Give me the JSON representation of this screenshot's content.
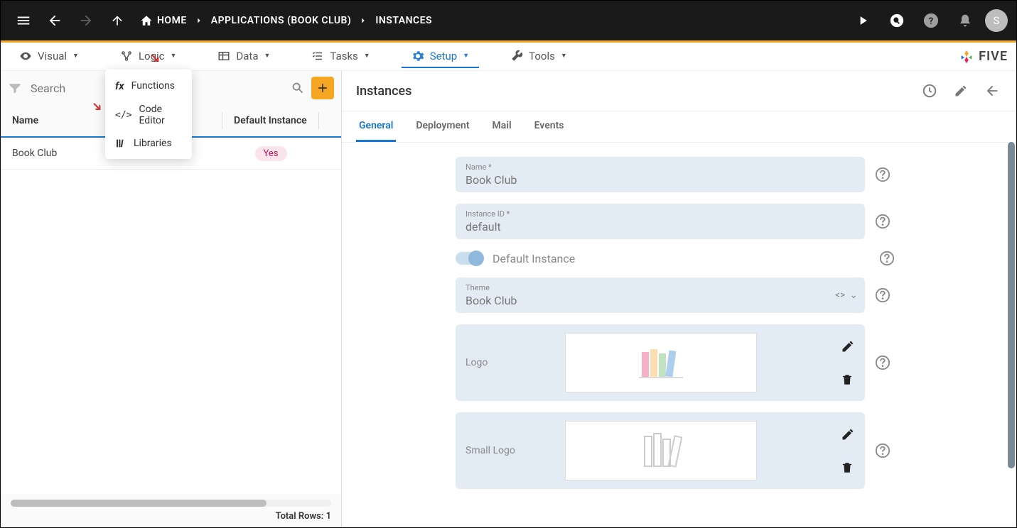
{
  "topbar": {
    "breadcrumbs": [
      {
        "label": "HOME"
      },
      {
        "label": "APPLICATIONS (BOOK CLUB)"
      },
      {
        "label": "INSTANCES"
      }
    ],
    "avatar_initial": "S"
  },
  "menubar": {
    "items": [
      {
        "label": "Visual"
      },
      {
        "label": "Logic"
      },
      {
        "label": "Data"
      },
      {
        "label": "Tasks"
      },
      {
        "label": "Setup",
        "active": true
      },
      {
        "label": "Tools"
      }
    ],
    "brand": "FIVE"
  },
  "logic_dropdown": {
    "items": [
      {
        "label": "Functions"
      },
      {
        "label": "Code Editor"
      },
      {
        "label": "Libraries"
      }
    ]
  },
  "left_panel": {
    "search_placeholder": "Search",
    "columns": [
      "Name",
      "",
      "Default Instance"
    ],
    "rows": [
      {
        "name": "Book Club",
        "instance_id": "default",
        "default": "Yes"
      }
    ],
    "total_label": "Total Rows:",
    "total_value": "1"
  },
  "right_panel": {
    "title": "Instances",
    "tabs": [
      "General",
      "Deployment",
      "Mail",
      "Events"
    ],
    "active_tab": "General",
    "fields": {
      "name": {
        "label": "Name *",
        "value": "Book Club"
      },
      "instance_id": {
        "label": "Instance ID *",
        "value": "default"
      },
      "default_instance": {
        "label": "Default Instance",
        "on": true
      },
      "theme": {
        "label": "Theme",
        "value": "Book Club"
      },
      "logo": {
        "label": "Logo"
      },
      "small_logo": {
        "label": "Small Logo"
      }
    }
  }
}
